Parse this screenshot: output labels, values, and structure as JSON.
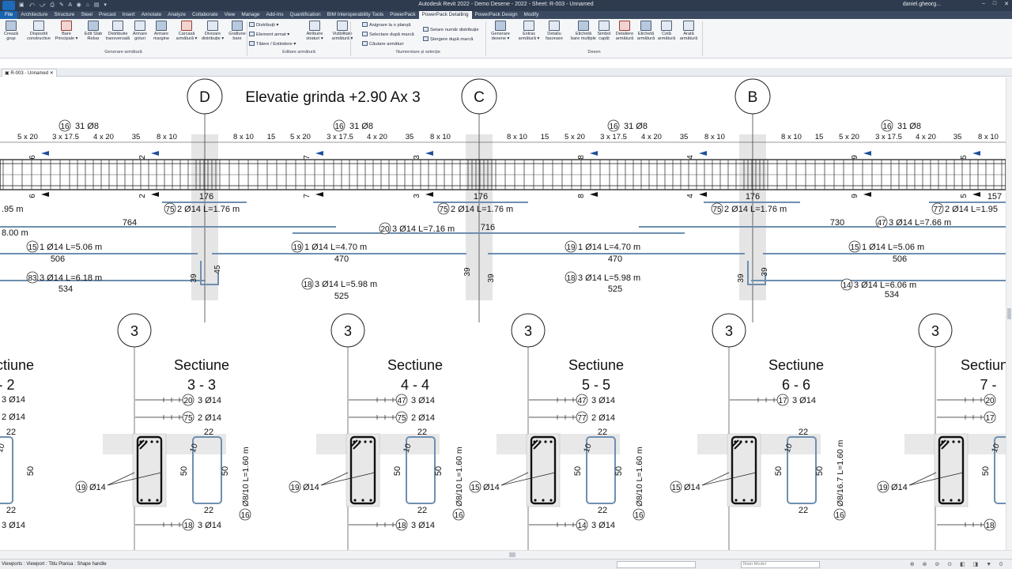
{
  "app": {
    "title": "Autodesk Revit 2022 - Demo Desene - 2022 - Sheet: R-003 - Unnamed",
    "user": "daniel.gheorg...",
    "doc_tab": "R-003 - Unnamed"
  },
  "ribbon_tabs": [
    "File",
    "Architecture",
    "Structure",
    "Steel",
    "Precast",
    "Insert",
    "Annotate",
    "Analyze",
    "Collaborate",
    "View",
    "Manage",
    "Add-Ins",
    "Quantification",
    "BIM Interoperability Tools",
    "PowerPack",
    "PowerPack Detailing",
    "PowerPack Design",
    "Modify"
  ],
  "active_tab": "PowerPack Detailing",
  "ribbon": {
    "big_buttons": [
      {
        "l1": "Crează",
        "l2": "grup"
      },
      {
        "l1": "Dispozitii",
        "l2": "constructive"
      },
      {
        "l1": "Bare",
        "l2": "Principale ▾"
      },
      {
        "l1": "Edit Slab",
        "l2": "Rebar"
      },
      {
        "l1": "Distributie",
        "l2": "transversală"
      },
      {
        "l1": "Armare",
        "l2": "goluri"
      },
      {
        "l1": "Armare",
        "l2": "margine"
      },
      {
        "l1": "Carcasă",
        "l2": "armătură ▾"
      },
      {
        "l1": "Divizare",
        "l2": "distribuție ▾"
      },
      {
        "l1": "Grafiune",
        "l2": "bare"
      },
      {
        "l1": "Atribuire",
        "l2": "straturi ▾"
      },
      {
        "l1": "Vizibilitate",
        "l2": "armătură ▾"
      },
      {
        "l1": "Generare",
        "l2": "desene ▾"
      },
      {
        "l1": "Extras",
        "l2": "armătură ▾"
      },
      {
        "l1": "Detaliu",
        "l2": "fasonare"
      },
      {
        "l1": "Etichetă",
        "l2": "bare multiple"
      },
      {
        "l1": "Simbol",
        "l2": "capăt"
      },
      {
        "l1": "Detaliere",
        "l2": "armătură"
      },
      {
        "l1": "Etichetă",
        "l2": "armătură"
      },
      {
        "l1": "Cotă",
        "l2": "armătură"
      },
      {
        "l1": "Arată",
        "l2": "armătură"
      }
    ],
    "small_editare": [
      "Distribuții ▾",
      "Element  armat ▾",
      "Tăiere  / Extindere ▾"
    ],
    "small_numerotare": [
      "Asignare la o planșă",
      "Selectare      după marcă",
      "Căutare armături",
      "Setare număr  distribuție",
      "Ștergere      după marcă"
    ],
    "groups": [
      "Generare armătură",
      "Editare armătură",
      "Numerotare și selecție",
      "Desen"
    ]
  },
  "drawing": {
    "elevation_title": "Elevatie grinda +2.90 Ax 3",
    "grid_bubbles": [
      "D",
      "C",
      "B"
    ],
    "spacing_labels_a": [
      "5 x 20",
      "3 x 17.5",
      "4 x 20",
      "35",
      "8 x 10"
    ],
    "spacing_labels_b": [
      "8 x 10",
      "15",
      "5 x 20",
      "3 x 17.5",
      "4 x 20",
      "35",
      "8 x 10"
    ],
    "stirrup_tags": [
      "16",
      "31 Ø8"
    ],
    "section_marks": [
      "6",
      "2",
      "7",
      "3",
      "8",
      "4",
      "9",
      "5"
    ],
    "dim_176": "176",
    "dim_157": "157",
    "left_bar_a": ".95 m",
    "left_bar_b": "8.00 m",
    "bars": [
      {
        "tag": "75",
        "text": "2 Ø14 L=1.76 m"
      },
      {
        "tag": "77",
        "text": "2 Ø14 L=1.95"
      },
      {
        "tag": "20",
        "text": "3 Ø14 L=7.16 m"
      },
      {
        "tag": "47",
        "text": "3 Ø14 L=7.66 m"
      },
      {
        "tag": "15",
        "text": "1 Ø14 L=5.06 m"
      },
      {
        "tag": "19",
        "text": "1 Ø14 L=4.70 m"
      },
      {
        "tag": "83",
        "text": "3 Ø14 L=6.18 m"
      },
      {
        "tag": "18",
        "text": "3 Ø14 L=5.98 m"
      },
      {
        "tag": "14",
        "text": "3 Ø14 L=6.06 m"
      }
    ],
    "lengths": {
      "l764": "764",
      "l716": "716",
      "l730": "730",
      "l506": "506",
      "l470": "470",
      "l534": "534",
      "l525": "525",
      "l39": "39",
      "l45": "45"
    },
    "section_axis": "3",
    "section_word": "Sectiune",
    "sections": [
      {
        "name": "- 2",
        "top1": "3 Ø14",
        "top2": "2 Ø14",
        "bot": "3 Ø14"
      },
      {
        "name": "3 - 3",
        "t1tag": "20",
        "top1": "3 Ø14",
        "t2tag": "75",
        "top2": "2 Ø14",
        "side": "19",
        "bottag": "18",
        "bot": "3 Ø14",
        "stir": "16",
        "stirtxt": "Ø8/10 L=1.60 m"
      },
      {
        "name": "4 - 4",
        "t1tag": "47",
        "top1": "3 Ø14",
        "t2tag": "75",
        "top2": "2 Ø14",
        "side": "19",
        "bottag": "18",
        "bot": "3 Ø14",
        "stir": "16",
        "stirtxt": "Ø8/10 L=1.60 m"
      },
      {
        "name": "5 - 5",
        "t1tag": "47",
        "top1": "3 Ø14",
        "t2tag": "77",
        "top2": "2 Ø14",
        "side": "15",
        "bottag": "14",
        "bot": "3 Ø14",
        "stir": "16",
        "stirtxt": "Ø8/10 L=1.60 m"
      },
      {
        "name": "6 - 6",
        "t1tag": "17",
        "top1": "3 Ø14",
        "side": "15",
        "stir": "16",
        "stirtxt": "Ø8/16.7 L=1.60 m"
      },
      {
        "name": "7 -",
        "t1tag": "20",
        "t2tag": "17",
        "side": "19",
        "bottag": "18"
      }
    ],
    "section_dims": {
      "d22": "22",
      "d50": "50",
      "d10": "10",
      "phi14": "Ø14"
    }
  },
  "status": {
    "message": "Viewports : Viewport : Titlu Plansa : Shape handle",
    "model": "Main Model",
    "zero": "0"
  },
  "colors": {
    "titlebar": "#2e3a4d",
    "tabbar": "#3b4a60",
    "file_tab": "#1a63ad",
    "rebar_blue": "#6e8fb0",
    "column_grey": "#d0d0d0"
  }
}
